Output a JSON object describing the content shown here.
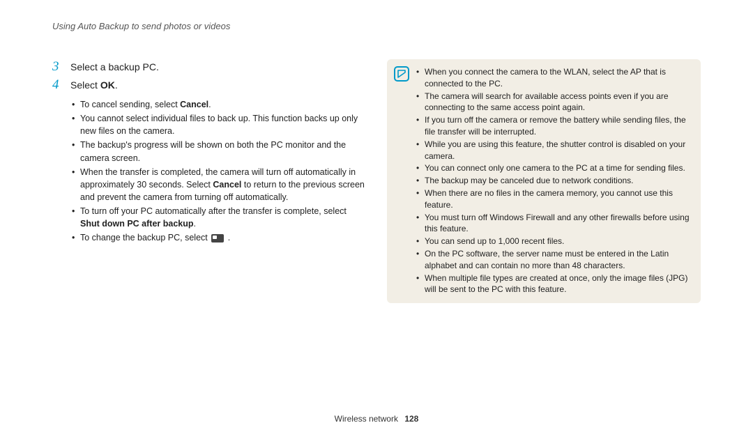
{
  "header": "Using Auto Backup to send photos or videos",
  "steps": {
    "s3": {
      "num": "3",
      "text": "Select a backup PC."
    },
    "s4": {
      "num": "4",
      "pre": "Select ",
      "bold": "OK",
      "post": "."
    }
  },
  "left_bullets": {
    "b1_pre": "To cancel sending, select ",
    "b1_bold": "Cancel",
    "b1_post": ".",
    "b2": "You cannot select individual files to back up. This function backs up only new files on the camera.",
    "b3": "The backup's progress will be shown on both the PC monitor and the camera screen.",
    "b4_pre": "When the transfer is completed, the camera will turn off automatically in approximately 30 seconds. Select ",
    "b4_bold": "Cancel",
    "b4_post": " to return to the previous screen and prevent the camera from turning off automatically.",
    "b5_pre": "To turn off your PC automatically after the transfer is complete, select ",
    "b5_bold": "Shut down PC after backup",
    "b5_post": ".",
    "b6_pre": "To change the backup PC, select ",
    "b6_post": " ."
  },
  "notes": {
    "n1": "When you connect the camera to the WLAN, select the AP that is connected to the PC.",
    "n2": "The camera will search for available access points even if you are connecting to the same access point again.",
    "n3": "If you turn off the camera or remove the battery while sending files, the file transfer will be interrupted.",
    "n4": "While you are using this feature, the shutter control is disabled on your camera.",
    "n5": "You can connect only one camera to the PC at a time for sending files.",
    "n6": "The backup may be canceled due to network conditions.",
    "n7": "When there are no files in the camera memory, you cannot use this feature.",
    "n8": "You must turn off Windows Firewall and any other firewalls before using this feature.",
    "n9": "You can send up to 1,000 recent files.",
    "n10": "On the PC software, the server name must be entered in the Latin alphabet and can contain no more than 48 characters.",
    "n11": "When multiple file types are created at once, only the image files (JPG) will be sent to the PC with this feature."
  },
  "footer": {
    "section": "Wireless network",
    "page": "128"
  }
}
